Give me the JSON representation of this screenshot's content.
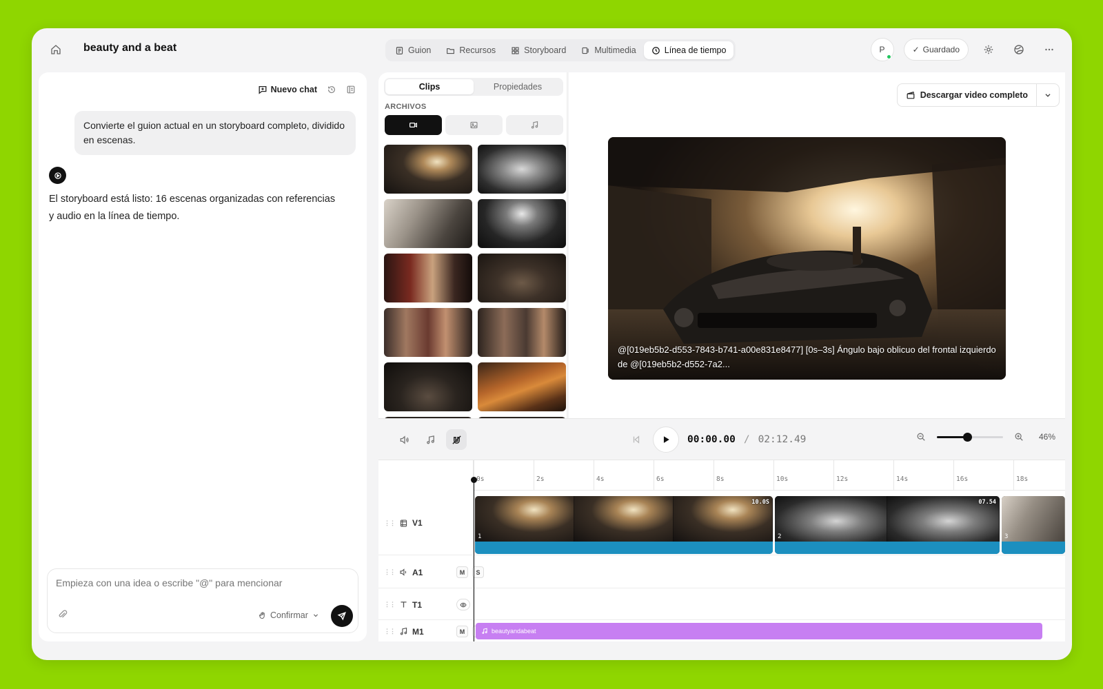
{
  "header": {
    "project_title": "beauty and a beat",
    "tabs": [
      {
        "label": "Guion",
        "icon": "script-icon"
      },
      {
        "label": "Recursos",
        "icon": "folder-icon"
      },
      {
        "label": "Storyboard",
        "icon": "grid-icon"
      },
      {
        "label": "Multimedia",
        "icon": "media-icon"
      },
      {
        "label": "Línea de tiempo",
        "icon": "clock-icon",
        "active": true
      }
    ],
    "avatar_initial": "P",
    "saved_label": "Guardado"
  },
  "chat": {
    "new_chat_label": "Nuevo chat",
    "user_message": "Convierte el guion actual en un storyboard completo, dividido en escenas.",
    "bot_message": "El storyboard está listo: 16 escenas organizadas con referencias y audio en la línea de tiempo.",
    "composer_placeholder": "Empieza con una idea o escribe \"@\" para mencionar",
    "confirm_label": "Confirmar"
  },
  "media": {
    "segment_tabs": [
      "Clips",
      "Propiedades"
    ],
    "files_label": "ARCHIVOS",
    "filters": [
      "video-icon",
      "image-icon",
      "music-icon"
    ]
  },
  "preview": {
    "download_label": "Descargar video completo",
    "caption": "@[019eb5b2-d553-7843-b741-a00e831e8477] [0s–3s] Ángulo bajo oblicuo del frontal izquierdo de @[019eb5b2-d552-7a2..."
  },
  "transport": {
    "current_time": "00:00.00",
    "separator": "/",
    "total_time": "02:12.49",
    "zoom_level": 0.46,
    "zoom_label": "46%"
  },
  "timeline": {
    "ruler_labels": [
      "0s",
      "2s",
      "4s",
      "6s",
      "8s",
      "10s",
      "12s",
      "14s",
      "16s",
      "18s"
    ],
    "tracks": {
      "v1": "V1",
      "a1": "A1",
      "t1": "T1",
      "m1": "M1"
    },
    "mute_label": "M",
    "solo_label": "S",
    "clips": [
      {
        "number": "1",
        "duration": "10.0S"
      },
      {
        "number": "2",
        "duration": "07.54"
      },
      {
        "number": "3",
        "duration": ""
      }
    ],
    "music_clip_label": "beautyandabeat"
  },
  "colors": {
    "background": "#8fd600",
    "music_track": "#c77ff2",
    "audio_wave": "#1c8fbf",
    "online_dot": "#22c55e"
  }
}
